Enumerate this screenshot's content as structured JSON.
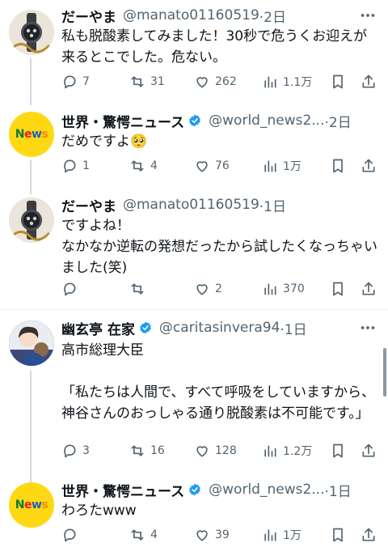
{
  "tweets": [
    {
      "name": "だーやま",
      "handle": "@manato01160519",
      "time": "·2日",
      "text": "私も脱酸素してみました！30秒で危うくお迎えが来るとこでした。危ない。",
      "reply": "7",
      "retweet": "31",
      "like": "262",
      "views": "1.1万"
    },
    {
      "name": "世界・驚愕ニュース",
      "handle": "@world_news2...",
      "time": "·2日",
      "text": "だめですよ🥺",
      "reply": "1",
      "retweet": "4",
      "like": "76",
      "views": "1万"
    },
    {
      "name": "だーやま",
      "handle": "@manato01160519",
      "time": "·1日",
      "text": "ですよね！\nなかなか逆転の発想だったから試したくなっちゃいました(笑)",
      "reply": "",
      "retweet": "",
      "like": "2",
      "views": "370"
    },
    {
      "name": "幽玄亭 在家",
      "handle": "@caritasinvera94",
      "time": "·1日",
      "text": "高市総理大臣\n\n「私たちは人間で、すべて呼吸をしていますから、神谷さんのおっしゃる通り脱酸素は不可能です。」",
      "reply": "3",
      "retweet": "16",
      "like": "128",
      "views": "1.2万"
    },
    {
      "name": "世界・驚愕ニュース",
      "handle": "@world_news2...",
      "time": "·1日",
      "text": "わろたwww",
      "reply": "",
      "retweet": "4",
      "like": "39",
      "views": "1万"
    }
  ],
  "logo_text": "News",
  "colors": {
    "accent": "#1d9bf0",
    "muted": "#536471",
    "news_bg": "#ffd814"
  }
}
